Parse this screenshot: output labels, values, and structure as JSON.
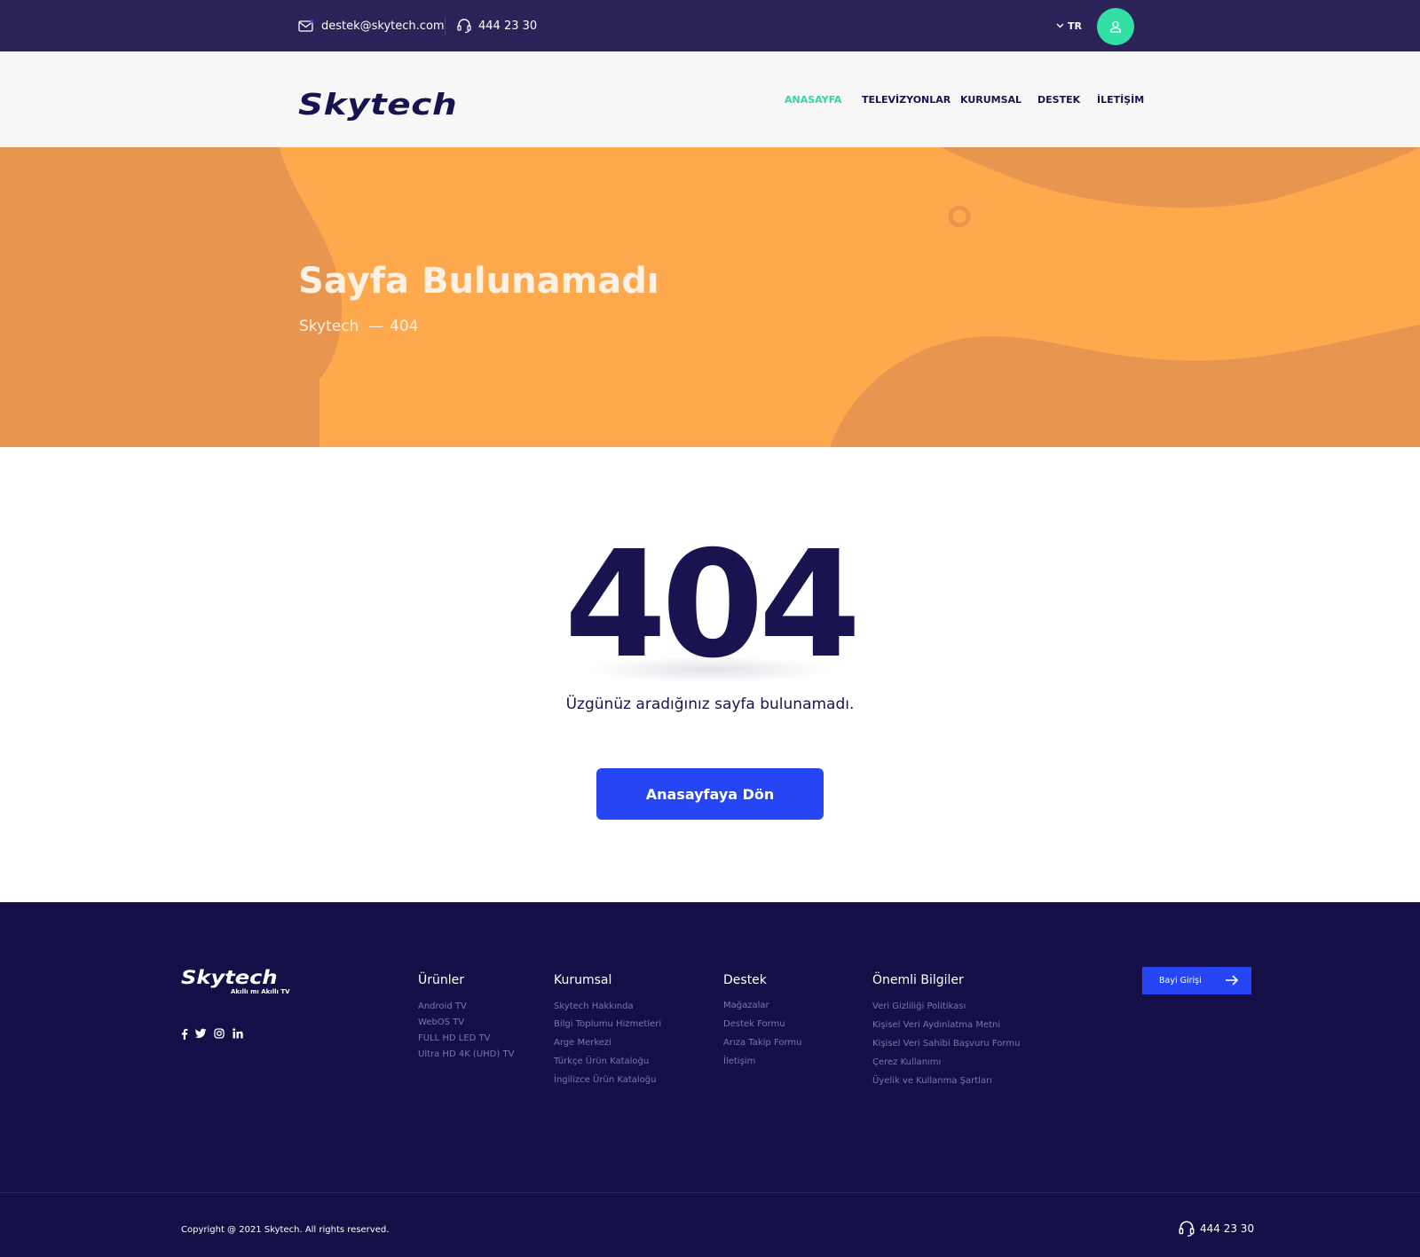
{
  "topbar": {
    "email": "destek@skytech.com",
    "phone": "444 23 30",
    "language": "TR"
  },
  "header": {
    "logo": "Skytech",
    "nav": [
      "ANASAYFA",
      "TELEVİZYONLAR",
      "KURUMSAL",
      "DESTEK",
      "İLETİŞİM"
    ],
    "active_nav": "ANASAYFA"
  },
  "hero": {
    "title": "Sayfa Bulunamadı",
    "breadcrumb": [
      "Skytech",
      "—",
      "404"
    ]
  },
  "content": {
    "code": "404",
    "message": "Üzgünüz aradığınız sayfa bulunamadı.",
    "button": "Anasayfaya Dön"
  },
  "footer": {
    "logo": "Skytech",
    "tagline": "Akıllı mı Akıllı TV",
    "social_icons": [
      "facebook-icon",
      "twitter-icon",
      "instagram-icon",
      "linkedin-icon"
    ],
    "columns": [
      {
        "title": "Ürünler",
        "links": [
          "Android TV",
          "WebOS TV",
          "FULL HD LED TV",
          "Ultra HD 4K (UHD) TV"
        ]
      },
      {
        "title": "Kurumsal",
        "links": [
          "Skytech Hakkında",
          "Bilgi Toplumu Hizmetleri",
          "Arge Merkezi",
          "Türkçe Ürün Kataloğu",
          "İngilizce Ürün Kataloğu"
        ]
      },
      {
        "title": "Destek",
        "links": [
          "Mağazalar",
          "Destek Formu",
          "Arıza Takip Formu",
          "İletişim"
        ]
      },
      {
        "title": "Önemli Bilgiler",
        "links": [
          "Veri Gizliliği Politikası",
          "Kişisel Veri Aydınlatma Metni",
          "Kişisel Veri Sahibi Başvuru Formu",
          "Çerez Kullanımı",
          "Üyelik ve Kullanma Şartları"
        ]
      }
    ],
    "dealer_button": "Bayi Girişi",
    "copyright": "Copyright @ 2021 Skytech. All rights reserved.",
    "phone": "444 23 30"
  },
  "colors": {
    "topbar": "#2b2258",
    "accent_green": "#32e0a4",
    "hero_orange": "#ffa94f",
    "hero_orange_dark": "#e8964f",
    "primary_blue": "#2645f5",
    "navy": "#19144f",
    "footer": "#150f48"
  }
}
